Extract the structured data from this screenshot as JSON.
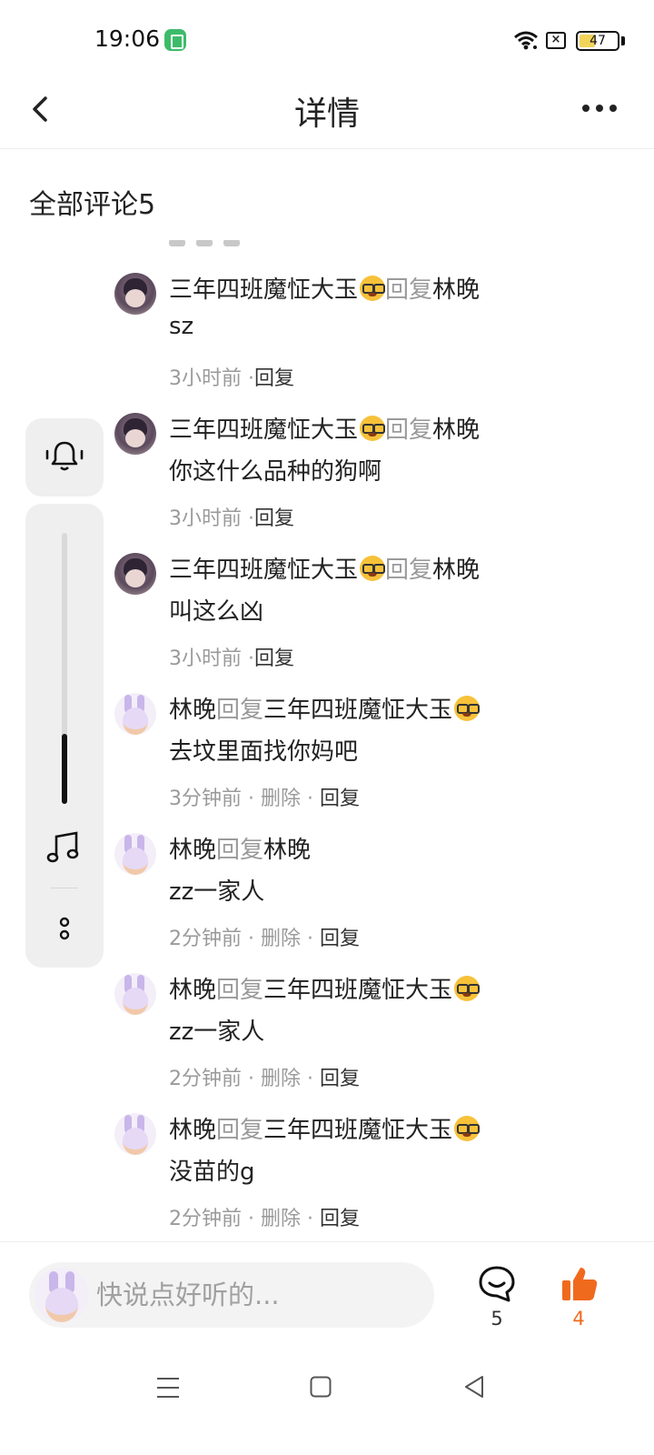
{
  "status_bar": {
    "time": "19:06",
    "battery_level": "47",
    "battery_fraction": 0.47
  },
  "header": {
    "title": "详情"
  },
  "comments_section": {
    "title": "全部评论5"
  },
  "comments": [
    {
      "author": "三年四班魔怔大玉",
      "author_emoji": "nerd-face-emoji",
      "reply_word": "回复",
      "reply_to": "林晚",
      "text": "sz",
      "time": "3小时前",
      "actions": " ·",
      "delete_label": "",
      "reply_label": "回复",
      "avatar": "dark"
    },
    {
      "author": "三年四班魔怔大玉",
      "author_emoji": "nerd-face-emoji",
      "reply_word": "回复",
      "reply_to": "林晚",
      "text": "你这什么品种的狗啊",
      "time": "3小时前",
      "actions": " ·",
      "delete_label": "",
      "reply_label": "回复",
      "avatar": "dark"
    },
    {
      "author": "三年四班魔怔大玉",
      "author_emoji": "nerd-face-emoji",
      "reply_word": "回复",
      "reply_to": "林晚",
      "text": "叫这么凶",
      "time": "3小时前",
      "actions": " ·",
      "delete_label": "",
      "reply_label": "回复",
      "avatar": "dark"
    },
    {
      "author": "林晚",
      "reply_word": "回复",
      "reply_to": "三年四班魔怔大玉",
      "reply_to_emoji": "nerd-face-emoji",
      "text": "去坟里面找你妈吧",
      "time": "3分钟前",
      "actions": " · ",
      "delete_label": "删除",
      "sep": " · ",
      "reply_label": "回复",
      "avatar": "bunny"
    },
    {
      "author": "林晚",
      "reply_word": "回复",
      "reply_to": "林晚",
      "text": "zz一家人",
      "time": "2分钟前",
      "actions": " · ",
      "delete_label": "删除",
      "sep": " · ",
      "reply_label": "回复",
      "avatar": "bunny"
    },
    {
      "author": "林晚",
      "reply_word": "回复",
      "reply_to": "三年四班魔怔大玉",
      "reply_to_emoji": "nerd-face-emoji",
      "text": "zz一家人",
      "time": "2分钟前",
      "actions": " · ",
      "delete_label": "删除",
      "sep": " · ",
      "reply_label": "回复",
      "avatar": "bunny"
    },
    {
      "author": "林晚",
      "reply_word": "回复",
      "reply_to": "三年四班魔怔大玉",
      "reply_to_emoji": "nerd-face-emoji",
      "text": "没苗的g",
      "time": "2分钟前",
      "actions": " · ",
      "delete_label": "删除",
      "sep": " · ",
      "reply_label": "回复",
      "avatar": "bunny"
    }
  ],
  "floating_panel": {
    "volume_fraction": 0.26
  },
  "bottom_bar": {
    "input_placeholder": "快说点好听的...",
    "comment_count": "5",
    "like_count": "4",
    "like_color": "#f06a1d"
  }
}
